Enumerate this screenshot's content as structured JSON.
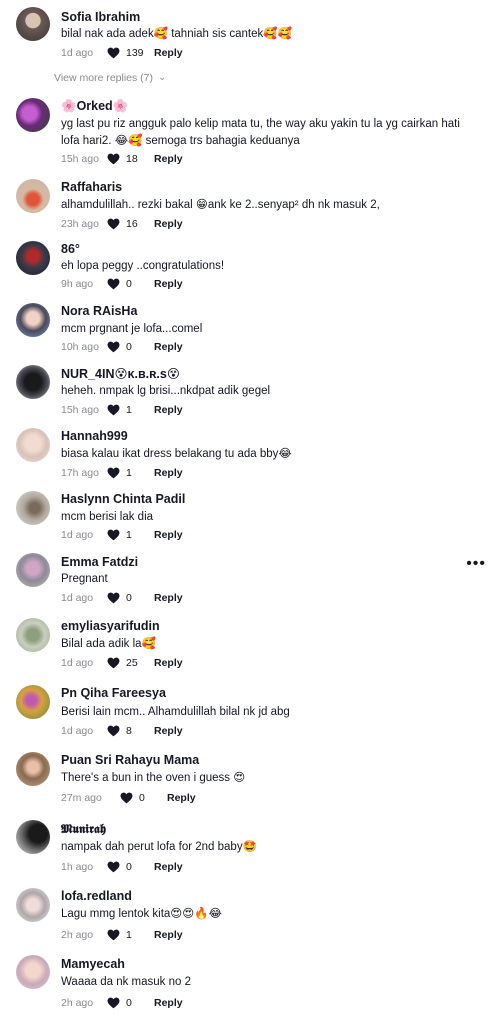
{
  "comments": [
    {
      "user": "Sofia Ibrahim",
      "text": "bilal nak ada adek🥰 tahniah sis cantek🥰🥰",
      "time": "1d ago",
      "likes": "139",
      "reply": "Reply"
    },
    {
      "user": "🌸Orked🌸",
      "text": "yg last pu riz angguk palo kelip mata tu, the way aku yakin tu la yg cairkan hati lofa hari2. 😂🥰 semoga trs bahagia keduanya",
      "time": "15h ago",
      "likes": "18",
      "reply": "Reply"
    },
    {
      "user": "Raffaharis",
      "text": "alhamdulillah.. rezki bakal 😁ank ke 2..senyap² dh nk masuk 2,",
      "time": "23h ago",
      "likes": "16",
      "reply": "Reply"
    },
    {
      "user": "86°",
      "text": "eh lopa peggy ..congratulations!",
      "time": "9h ago",
      "likes": "0",
      "reply": "Reply"
    },
    {
      "user": "Nora RAisHa",
      "text": "mcm prgnant je lofa...comel",
      "time": "10h ago",
      "likes": "0",
      "reply": "Reply"
    },
    {
      "user": "NUR_4IN😵ᴋ.ʙ.ʀ.s😵",
      "text": "heheh. nmpak lg brisi...nkdpat adik gegel",
      "time": "15h ago",
      "likes": "1",
      "reply": "Reply"
    },
    {
      "user": "Hannah999",
      "text": "biasa kalau ikat dress belakang tu ada bby😂",
      "time": "17h ago",
      "likes": "1",
      "reply": "Reply"
    },
    {
      "user": "Haslynn Chinta Padil",
      "text": "mcm berisi lak dia",
      "time": "1d ago",
      "likes": "1",
      "reply": "Reply"
    },
    {
      "user": "Emma Fatdzi",
      "text": "Pregnant",
      "time": "1d ago",
      "likes": "0",
      "reply": "Reply"
    },
    {
      "user": "emyliasyarifudin",
      "text": "Bilal ada adik la🥰",
      "time": "1d ago",
      "likes": "25",
      "reply": "Reply"
    },
    {
      "user": "Pn Qiha Fareesya",
      "text": "Berisi lain mcm.. Alhamdulillah bilal nk jd abg",
      "time": "1d ago",
      "likes": "8",
      "reply": "Reply"
    },
    {
      "user": "Puan Sri Rahayu Mama",
      "text": "There's a bun in the oven i guess 😍",
      "time": "27m ago",
      "likes": "0",
      "reply": "Reply"
    },
    {
      "user": "𝕸𝖚𝖓𝖎𝖗𝖆𝖍",
      "text": "nampak dah perut lofa for 2nd baby🤩",
      "time": "1h ago",
      "likes": "0",
      "reply": "Reply"
    },
    {
      "user": "lofa.redland",
      "text": "Lagu mmg lentok kita😍😍🔥😂",
      "time": "2h ago",
      "likes": "1",
      "reply": "Reply"
    },
    {
      "user": "Mamyecah",
      "text": "Waaaa da nk masuk no 2",
      "time": "2h ago",
      "likes": "0",
      "reply": "Reply"
    }
  ],
  "view_more_replies": "View more replies (7)",
  "more_options": "•••",
  "colors": {
    "text": "#161823",
    "secondary": "#8a8b91",
    "heart": "#161823"
  }
}
